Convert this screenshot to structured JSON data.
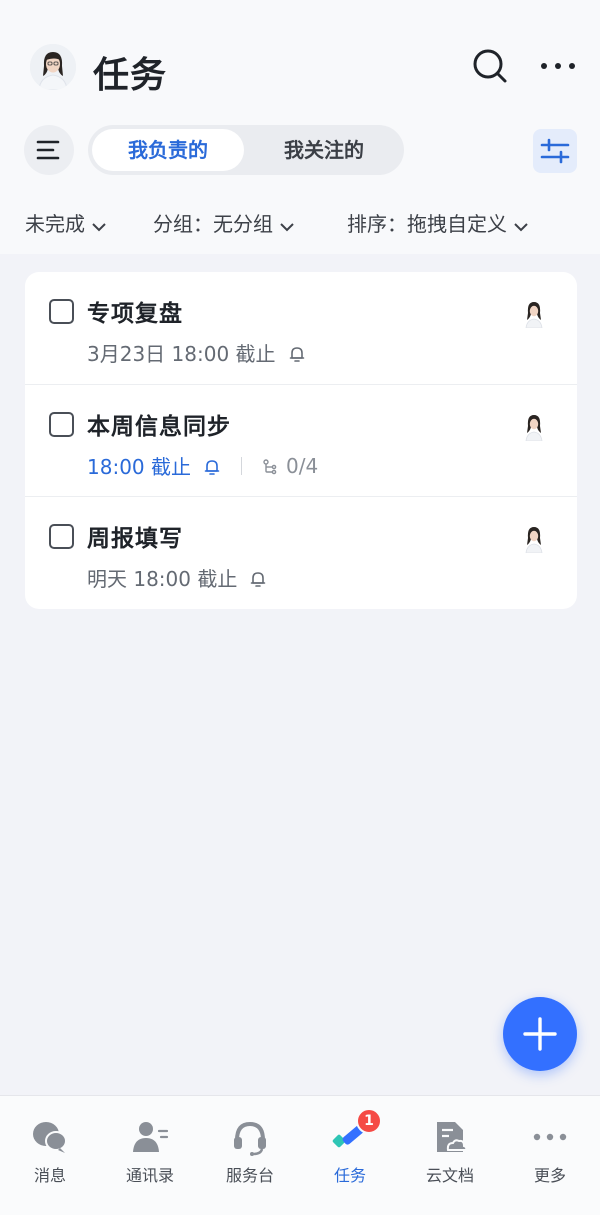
{
  "header": {
    "title": "任务",
    "tabs": [
      {
        "label": "我负责的",
        "active": true
      },
      {
        "label": "我关注的",
        "active": false
      }
    ],
    "filters": {
      "status": "未完成",
      "group": "分组：无分组",
      "sort": "排序：拖拽自定义"
    }
  },
  "tasks": [
    {
      "title": "专项复盘",
      "due": "3月23日 18:00 截止",
      "due_color": "#646a73",
      "subtasks": null
    },
    {
      "title": "本周信息同步",
      "due": "18:00 截止",
      "due_color": "#2a6ad9",
      "subtasks": "0/4"
    },
    {
      "title": "周报填写",
      "due": "明天 18:00 截止",
      "due_color": "#646a73",
      "subtasks": null
    }
  ],
  "bottom_nav": {
    "items": [
      {
        "label": "消息",
        "icon": "chat-bubbles-icon",
        "active": false
      },
      {
        "label": "通讯录",
        "icon": "contacts-icon",
        "active": false
      },
      {
        "label": "服务台",
        "icon": "headset-icon",
        "active": false
      },
      {
        "label": "任务",
        "icon": "tasks-check-icon",
        "active": true,
        "badge": "1"
      },
      {
        "label": "云文档",
        "icon": "cloud-doc-icon",
        "active": false
      },
      {
        "label": "更多",
        "icon": "more-dots-icon",
        "active": false
      }
    ]
  },
  "colors": {
    "accent": "#3370ff",
    "active_text": "#2a6ad9",
    "badge": "#f54a45"
  }
}
